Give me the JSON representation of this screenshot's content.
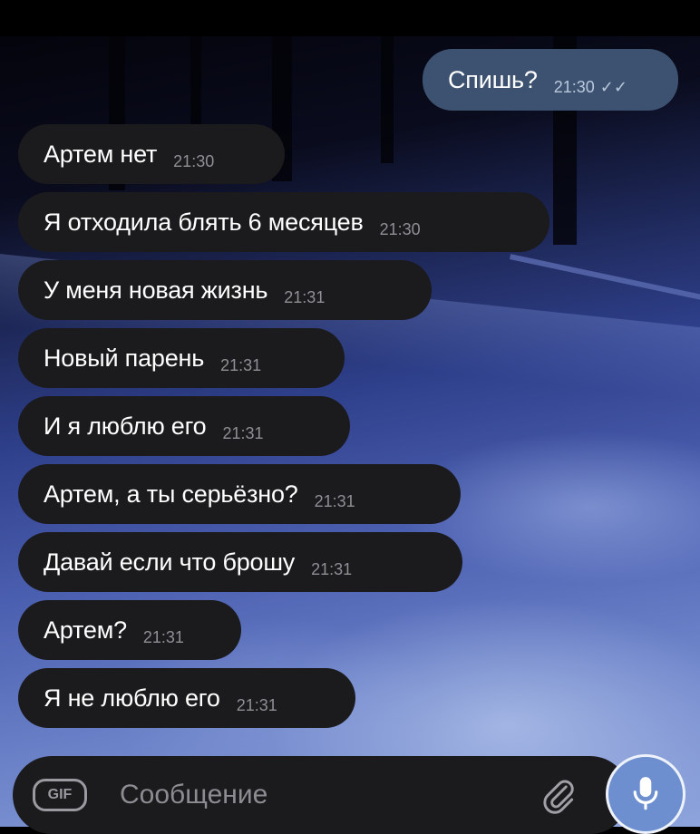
{
  "chat": {
    "outgoing": [
      {
        "text": "Спишь?",
        "time": "21:30",
        "status": "read"
      }
    ],
    "incoming": [
      {
        "text": "Артем нет",
        "time": "21:30"
      },
      {
        "text": "Я отходила блять 6 месяцев",
        "time": "21:30"
      },
      {
        "text": "У меня новая жизнь",
        "time": "21:31"
      },
      {
        "text": "Новый парень",
        "time": "21:31"
      },
      {
        "text": "И я люблю его",
        "time": "21:31"
      },
      {
        "text": "Артем, а ты серьёзно?",
        "time": "21:31"
      },
      {
        "text": "Давай если что брошу",
        "time": "21:31"
      },
      {
        "text": "Артем?",
        "time": "21:31"
      },
      {
        "text": "Я не люблю его",
        "time": "21:31"
      }
    ]
  },
  "composer": {
    "gif_label": "GIF",
    "placeholder": "Сообщение",
    "attach_icon": "paperclip-icon",
    "mic_icon": "microphone-icon"
  },
  "colors": {
    "incoming_bubble": "#1b1b1d",
    "outgoing_bubble": "#3d5270",
    "mic_button": "#6d8fd0"
  }
}
